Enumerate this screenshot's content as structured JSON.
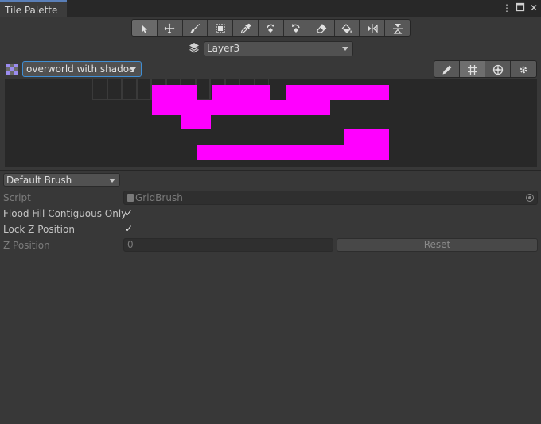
{
  "window": {
    "tab_title": "Tile Palette",
    "menu_icon": "kebab-menu-icon",
    "maximize_icon": "maximize-icon",
    "close_icon": "close-icon"
  },
  "toolbar": {
    "tools": [
      {
        "name": "select-tool",
        "icon": "cursor-arrow-icon"
      },
      {
        "name": "move-tool",
        "icon": "move-arrows-icon"
      },
      {
        "name": "paint-tool",
        "icon": "paintbrush-icon"
      },
      {
        "name": "box-fill-tool",
        "icon": "box-fill-icon"
      },
      {
        "name": "picker-tool",
        "icon": "eyedropper-icon"
      },
      {
        "name": "rotate-clockwise-tool",
        "icon": "rotate-clockwise-icon"
      },
      {
        "name": "rotate-counterclockwise-tool",
        "icon": "rotate-counterclockwise-icon"
      },
      {
        "name": "erase-tool",
        "icon": "eraser-icon"
      },
      {
        "name": "fill-tool",
        "icon": "paint-bucket-icon"
      },
      {
        "name": "flip-x-tool",
        "icon": "flip-horizontal-icon"
      },
      {
        "name": "flip-y-tool",
        "icon": "flip-vertical-icon"
      }
    ]
  },
  "layer": {
    "icon": "layers-icon",
    "selected": "Layer3"
  },
  "palette": {
    "icon": "palette-icon",
    "selected": "overworld with shadoe",
    "tools": [
      {
        "name": "edit-palette-button",
        "icon": "pencil-icon"
      },
      {
        "name": "toggle-grid-button",
        "icon": "grid-icon"
      },
      {
        "name": "gizmos-button",
        "icon": "gizmo-icon"
      },
      {
        "name": "palette-settings-button",
        "icon": "settings-icon"
      }
    ],
    "tile_color": "#ff00ff"
  },
  "brush": {
    "selected": "Default Brush",
    "script_label": "Script",
    "script_value": "GridBrush",
    "flood_fill_label": "Flood Fill Contiguous Only",
    "flood_fill_checked": "✓",
    "lock_z_label": "Lock Z Position",
    "lock_z_checked": "✓",
    "z_position_label": "Z Position",
    "z_position_value": "0",
    "reset_label": "Reset"
  }
}
